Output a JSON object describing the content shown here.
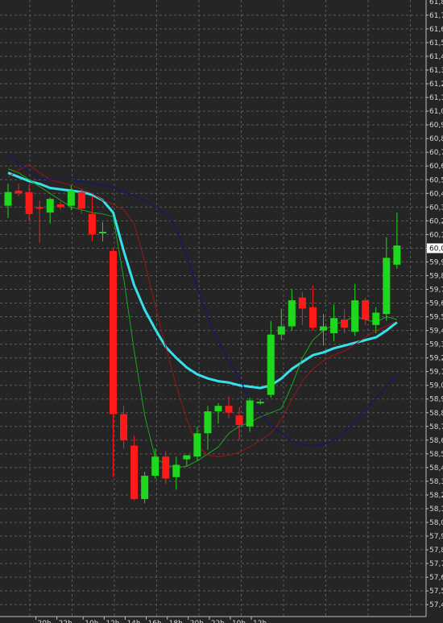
{
  "chart_data": {
    "type": "candlestick",
    "title": "",
    "xlabel": "",
    "ylabel": "",
    "ylim": [
      57.36,
      61.8
    ],
    "grid": true,
    "legend": "none",
    "y_ticks": [
      "61,7",
      "61,6",
      "61,5",
      "61,4",
      "61,3",
      "61,2",
      "61,1",
      "61,0",
      "60,9",
      "60,8",
      "60,7",
      "60,6",
      "60,5",
      "60,4",
      "60,3",
      "60,2",
      "60,1",
      "60,0",
      "59,9",
      "59,8",
      "59,7",
      "59,6",
      "59,5",
      "59,4",
      "59,3",
      "59,2",
      "59,1",
      "59,0",
      "58,9",
      "58,8",
      "58,7",
      "58,6",
      "58,5",
      "58,4",
      "58,3",
      "58,2",
      "58,1",
      "58,0",
      "57,9",
      "57,8",
      "57,7",
      "57,6",
      "57,5",
      "57,4"
    ],
    "y_tick_values": [
      61.7,
      61.6,
      61.5,
      61.4,
      61.3,
      61.2,
      61.1,
      61.0,
      60.9,
      60.8,
      60.7,
      60.6,
      60.5,
      60.4,
      60.3,
      60.2,
      60.1,
      60.0,
      59.9,
      59.8,
      59.7,
      59.6,
      59.5,
      59.4,
      59.3,
      59.2,
      59.1,
      59.0,
      58.9,
      58.8,
      58.7,
      58.6,
      58.5,
      58.4,
      58.3,
      58.2,
      58.1,
      58.0,
      57.9,
      57.8,
      57.7,
      57.6,
      57.5,
      57.4
    ],
    "top_partial_tick": "61,8",
    "current_price_label": "60,0",
    "current_price": 60.0,
    "x_ticks": [
      "20h",
      "22h",
      "10h",
      "12h",
      "14h",
      "16h",
      "18h",
      "20h",
      "22h",
      "10h",
      "12h"
    ],
    "x_tick_positions": [
      0.5,
      2.5,
      5,
      7,
      9,
      11,
      13,
      15,
      17,
      19,
      21
    ],
    "candles": [
      {
        "x": 0,
        "open": 60.31,
        "high": 60.47,
        "low": 60.22,
        "close": 60.41
      },
      {
        "x": 1,
        "open": 60.42,
        "high": 60.47,
        "low": 60.38,
        "close": 60.4
      },
      {
        "x": 2,
        "open": 60.41,
        "high": 60.46,
        "low": 60.2,
        "close": 60.25
      },
      {
        "x": 3,
        "open": 60.3,
        "high": 60.35,
        "low": 60.04,
        "close": 60.29
      },
      {
        "x": 4,
        "open": 60.26,
        "high": 60.37,
        "low": 60.18,
        "close": 60.36
      },
      {
        "x": 5,
        "open": 60.32,
        "high": 60.34,
        "low": 60.28,
        "close": 60.3
      },
      {
        "x": 6,
        "open": 60.31,
        "high": 60.46,
        "low": 60.28,
        "close": 60.42
      },
      {
        "x": 7,
        "open": 60.41,
        "high": 60.43,
        "low": 60.25,
        "close": 60.29
      },
      {
        "x": 8,
        "open": 60.25,
        "high": 60.38,
        "low": 60.05,
        "close": 60.1
      },
      {
        "x": 9,
        "open": 60.11,
        "high": 60.19,
        "low": 60.05,
        "close": 60.12
      },
      {
        "x": 10,
        "open": 59.98,
        "high": 60.0,
        "low": 58.33,
        "close": 58.79
      },
      {
        "x": 11,
        "open": 58.79,
        "high": 58.85,
        "low": 58.54,
        "close": 58.6
      },
      {
        "x": 12,
        "open": 58.56,
        "high": 58.63,
        "low": 58.16,
        "close": 58.17
      },
      {
        "x": 13,
        "open": 58.17,
        "high": 58.37,
        "low": 58.14,
        "close": 58.34
      },
      {
        "x": 14,
        "open": 58.34,
        "high": 58.54,
        "low": 58.32,
        "close": 58.48
      },
      {
        "x": 15,
        "open": 58.48,
        "high": 58.52,
        "low": 58.28,
        "close": 58.32
      },
      {
        "x": 16,
        "open": 58.33,
        "high": 58.48,
        "low": 58.24,
        "close": 58.42
      },
      {
        "x": 17,
        "open": 58.46,
        "high": 58.49,
        "low": 58.41,
        "close": 58.49
      },
      {
        "x": 18,
        "open": 58.48,
        "high": 58.7,
        "low": 58.45,
        "close": 58.65
      },
      {
        "x": 19,
        "open": 58.65,
        "high": 58.85,
        "low": 58.53,
        "close": 58.81
      },
      {
        "x": 20,
        "open": 58.81,
        "high": 58.87,
        "low": 58.72,
        "close": 58.85
      },
      {
        "x": 21,
        "open": 58.85,
        "high": 58.92,
        "low": 58.76,
        "close": 58.8
      },
      {
        "x": 22,
        "open": 58.78,
        "high": 58.84,
        "low": 58.6,
        "close": 58.71
      },
      {
        "x": 23,
        "open": 58.7,
        "high": 58.91,
        "low": 58.66,
        "close": 58.89
      },
      {
        "x": 24,
        "open": 58.88,
        "high": 58.9,
        "low": 58.86,
        "close": 58.88
      },
      {
        "x": 25,
        "open": 58.93,
        "high": 59.47,
        "low": 58.91,
        "close": 59.37
      },
      {
        "x": 26,
        "open": 59.37,
        "high": 59.56,
        "low": 59.33,
        "close": 59.43
      },
      {
        "x": 27,
        "open": 59.43,
        "high": 59.7,
        "low": 59.4,
        "close": 59.62
      },
      {
        "x": 28,
        "open": 59.64,
        "high": 59.68,
        "low": 59.44,
        "close": 59.56
      },
      {
        "x": 29,
        "open": 59.57,
        "high": 59.73,
        "low": 59.4,
        "close": 59.42
      },
      {
        "x": 30,
        "open": 59.4,
        "high": 59.52,
        "low": 59.29,
        "close": 59.43
      },
      {
        "x": 31,
        "open": 59.38,
        "high": 59.59,
        "low": 59.32,
        "close": 59.49
      },
      {
        "x": 32,
        "open": 59.48,
        "high": 59.56,
        "low": 59.38,
        "close": 59.42
      },
      {
        "x": 33,
        "open": 59.39,
        "high": 59.74,
        "low": 59.36,
        "close": 59.62
      },
      {
        "x": 34,
        "open": 59.62,
        "high": 59.64,
        "low": 59.44,
        "close": 59.48
      },
      {
        "x": 35,
        "open": 59.44,
        "high": 59.57,
        "low": 59.38,
        "close": 59.53
      },
      {
        "x": 36,
        "open": 59.52,
        "high": 60.08,
        "low": 59.47,
        "close": 59.93
      },
      {
        "x": 37,
        "open": 59.88,
        "high": 60.26,
        "low": 59.85,
        "close": 60.02
      }
    ],
    "series": [
      {
        "color": "#35e2ea",
        "values": [
          60.55,
          60.52,
          60.49,
          60.47,
          60.44,
          60.43,
          60.42,
          60.41,
          60.39,
          60.35,
          60.26,
          59.98,
          59.73,
          59.55,
          59.41,
          59.28,
          59.2,
          59.13,
          59.08,
          59.05,
          59.03,
          59.02,
          59.0,
          58.99,
          58.98,
          59.0,
          59.05,
          59.12,
          59.17,
          59.22,
          59.24,
          59.27,
          59.29,
          59.31,
          59.33,
          59.35,
          59.4,
          59.46
        ]
      },
      {
        "color": "#1aa61a",
        "values": [
          60.58,
          60.55,
          60.5,
          60.45,
          60.4,
          60.35,
          60.3,
          60.28,
          60.26,
          60.25,
          60.23,
          59.78,
          59.25,
          58.78,
          58.47,
          58.42,
          58.4,
          58.41,
          58.45,
          58.5,
          58.55,
          58.65,
          58.7,
          58.73,
          58.77,
          58.8,
          58.83,
          59.0,
          59.2,
          59.33,
          59.4,
          59.44,
          59.47,
          59.5,
          59.48,
          59.46,
          59.5,
          59.48
        ]
      },
      {
        "color": "#9a1616",
        "values": [
          60.52,
          60.57,
          60.61,
          60.55,
          60.5,
          60.48,
          60.46,
          60.43,
          60.4,
          60.35,
          60.32,
          60.28,
          60.18,
          59.9,
          59.58,
          59.28,
          59.0,
          58.75,
          58.56,
          58.49,
          58.48,
          58.49,
          58.51,
          58.55,
          58.6,
          58.65,
          58.75,
          58.9,
          59.03,
          59.12,
          59.18,
          59.22,
          59.25,
          59.3,
          59.35,
          59.4,
          59.43,
          59.47
        ]
      },
      {
        "color": "#151573",
        "values": [
          60.7,
          60.62,
          60.56,
          60.51,
          60.5,
          60.5,
          60.5,
          60.49,
          60.47,
          60.46,
          60.44,
          60.41,
          60.38,
          60.35,
          60.3,
          60.25,
          60.15,
          59.95,
          59.72,
          59.5,
          59.32,
          59.18,
          59.05,
          58.9,
          58.8,
          58.71,
          58.65,
          58.59,
          58.57,
          58.56,
          58.57,
          58.6,
          58.66,
          58.73,
          58.82,
          58.91,
          58.99,
          59.08
        ]
      }
    ]
  },
  "colors": {
    "background": "#252525",
    "grid": "#5a5a5a",
    "candle_up": "#1ed71e",
    "candle_down": "#ff1a1a",
    "axis_text": "#d8d8d8",
    "price_box_bg": "#ffffff",
    "price_box_text": "#111111"
  }
}
